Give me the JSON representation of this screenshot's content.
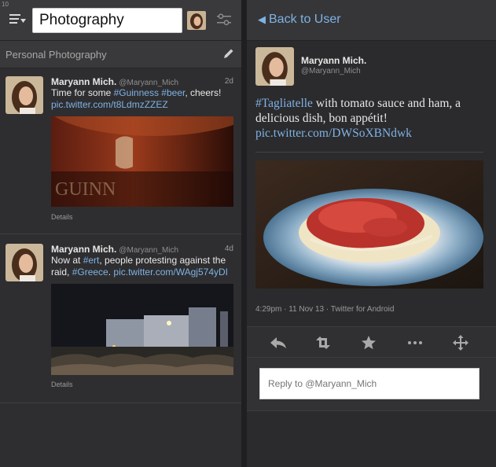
{
  "left": {
    "corner_number": "10",
    "search": {
      "value": "Photography"
    },
    "subhead": "Personal Photography",
    "tweets": [
      {
        "name": "Maryann Mich.",
        "handle": "@Maryann_Mich",
        "time": "2d",
        "text_parts": [
          "Time for some ",
          "#Guinness",
          " ",
          "#beer",
          ", cheers!"
        ],
        "link": "pic.twitter.com/t8LdmzZZEZ",
        "details": "Details"
      },
      {
        "name": "Maryann Mich.",
        "handle": "@Maryann_Mich",
        "time": "4d",
        "text_parts": [
          "Now at ",
          "#ert",
          ", people protesting against the raid, ",
          "#Greece",
          ". "
        ],
        "link": "pic.twitter.com/WAgj574yDI",
        "details": "Details"
      }
    ]
  },
  "right": {
    "back_label": "Back to User",
    "tweet": {
      "name": "Maryann Mich.",
      "handle": "@Maryann_Mich",
      "hashtag": "#Tagliatelle",
      "text": " with tomato sauce and ham, a delicious dish, bon appétit!",
      "link": "pic.twitter.com/DWSoXBNdwk",
      "meta": "4:29pm · 11 Nov 13 · Twitter for Android"
    },
    "actions": [
      "reply-icon",
      "retweet-icon",
      "favorite-star-icon",
      "more-icon",
      "move-icon"
    ],
    "reply_placeholder": "Reply to @Maryann_Mich"
  },
  "colors": {
    "link": "#7fb2e5",
    "background": "#2b2b2d"
  }
}
